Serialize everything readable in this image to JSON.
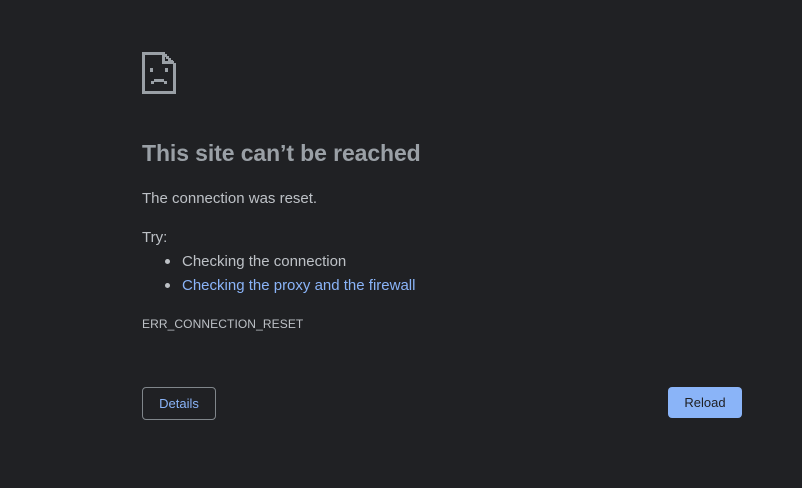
{
  "page": {
    "title": "This site can’t be reached",
    "message": "The connection was reset.",
    "try_label": "Try:",
    "suggestions": [
      {
        "text": "Checking the connection",
        "is_link": false
      },
      {
        "text": "Checking the proxy and the firewall",
        "is_link": true
      }
    ],
    "error_code": "ERR_CONNECTION_RESET"
  },
  "buttons": {
    "details_label": "Details",
    "reload_label": "Reload"
  },
  "icons": {
    "error": "sad-page-icon"
  },
  "colors": {
    "background": "#202124",
    "title": "#9aa0a6",
    "text": "#bdc1c6",
    "link": "#8ab4f8",
    "button_primary_bg": "#8ab4f8",
    "button_border": "#80868b"
  }
}
